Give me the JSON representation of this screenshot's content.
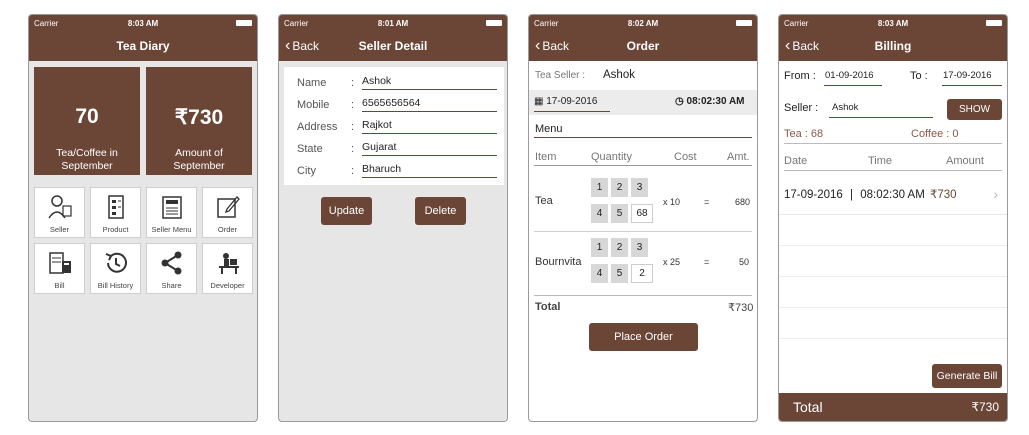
{
  "status": {
    "carrier": "Carrier",
    "times": [
      "8:03 AM",
      "8:01 AM",
      "8:02 AM",
      "8:03 AM"
    ]
  },
  "home": {
    "title": "Tea Diary",
    "tile_count": {
      "value": "70",
      "caption_line1": "Tea/Coffee in",
      "caption_line2": "September"
    },
    "tile_amount": {
      "value": "₹730",
      "caption_line1": "Amount of",
      "caption_line2": "September"
    },
    "menu": [
      {
        "label": "Seller",
        "icon": "seller-icon"
      },
      {
        "label": "Product",
        "icon": "product-icon"
      },
      {
        "label": "Seller Menu",
        "icon": "seller-menu-icon"
      },
      {
        "label": "Order",
        "icon": "order-icon"
      },
      {
        "label": "Bill",
        "icon": "bill-icon"
      },
      {
        "label": "Bill History",
        "icon": "bill-history-icon"
      },
      {
        "label": "Share",
        "icon": "share-icon"
      },
      {
        "label": "Developer",
        "icon": "developer-icon"
      }
    ]
  },
  "seller_detail": {
    "back": "Back",
    "title": "Seller Detail",
    "fields": [
      {
        "label": "Name",
        "value": "Ashok"
      },
      {
        "label": "Mobile",
        "value": "6565656564"
      },
      {
        "label": "Address",
        "value": "Rajkot"
      },
      {
        "label": "State",
        "value": "Gujarat"
      },
      {
        "label": "City",
        "value": "Bharuch"
      }
    ],
    "update": "Update",
    "delete": "Delete"
  },
  "order": {
    "back": "Back",
    "title": "Order",
    "seller_label": "Tea Seller :",
    "seller_value": "Ashok",
    "date": "17-09-2016",
    "time": "08:02:30 AM",
    "menu_label": "Menu",
    "columns": [
      "Item",
      "Quantity",
      "Cost",
      "Amt."
    ],
    "items": [
      {
        "name": "Tea",
        "keys_top": [
          "1",
          "2",
          "3"
        ],
        "keys_bottom": [
          "4",
          "5"
        ],
        "qty": "68",
        "cost": "x 10",
        "eq": "=",
        "amt": "680"
      },
      {
        "name": "Bournvita",
        "keys_top": [
          "1",
          "2",
          "3"
        ],
        "keys_bottom": [
          "4",
          "5"
        ],
        "qty": "2",
        "cost": "x 25",
        "eq": "=",
        "amt": "50"
      }
    ],
    "total_label": "Total",
    "total_value": "₹730",
    "place_order": "Place Order"
  },
  "billing": {
    "back": "Back",
    "title": "Billing",
    "from_label": "From :",
    "from_value": "01-09-2016",
    "to_label": "To :",
    "to_value": "17-09-2016",
    "seller_label": "Seller :",
    "seller_value": "Ashok",
    "show": "SHOW",
    "tea_summary": "Tea :  68",
    "coffee_summary": "Coffee : 0",
    "columns": [
      "Date",
      "Time",
      "Amount"
    ],
    "row": {
      "date": "17-09-2016",
      "sep": "|",
      "time": "08:02:30 AM",
      "amount": "₹730",
      "chevron": "›"
    },
    "generate": "Generate Bill",
    "total_label": "Total",
    "total_value": "₹730"
  },
  "colors": {
    "brand": "#6b4536",
    "background": "#e6e6e6"
  }
}
